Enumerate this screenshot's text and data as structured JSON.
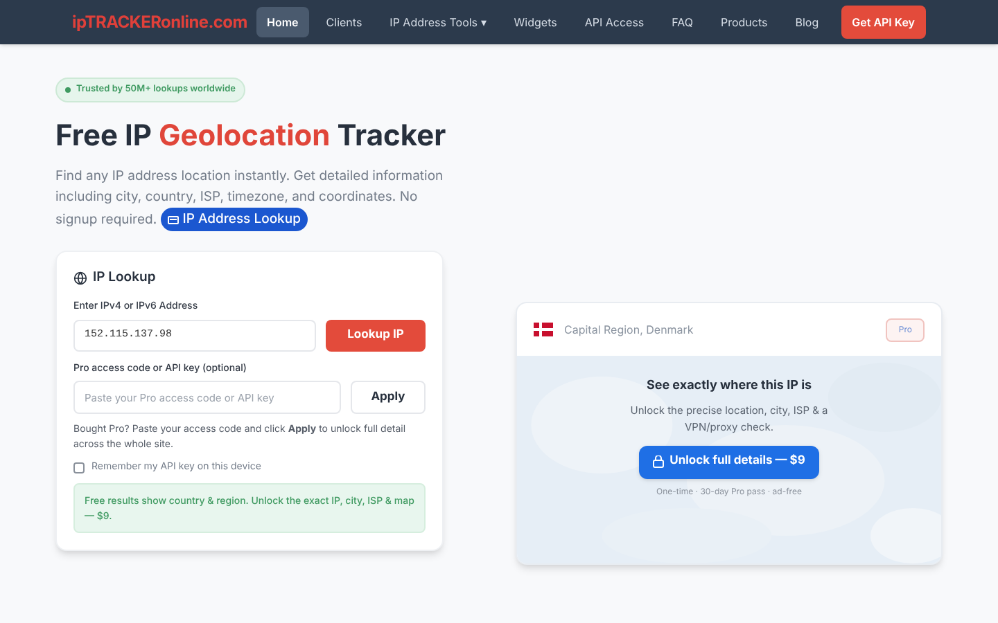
{
  "logo": "ipTRACKERonline.com",
  "nav": [
    {
      "label": "Home",
      "selected": true
    },
    {
      "label": "Clients",
      "selected": false
    },
    {
      "label": "IP Address Tools ▾",
      "selected": false
    },
    {
      "label": "Widgets",
      "selected": false
    },
    {
      "label": "API Access",
      "selected": false
    },
    {
      "label": "FAQ",
      "selected": false
    },
    {
      "label": "Products",
      "selected": false
    },
    {
      "label": "Blog",
      "selected": false
    }
  ],
  "cta": "Get API Key",
  "badge": "Trusted by 50M+ lookups worldwide",
  "heading": {
    "before": "Free IP ",
    "accent": "Geolocation",
    "after": " Tracker"
  },
  "intro": "Find any IP address location instantly. Get detailed information including city, country, ISP, timezone, and coordinates. No signup required.",
  "intro_link": "IP Address Lookup",
  "lookup": {
    "title": "IP Lookup",
    "ip_label": "Enter IPv4 or IPv6 Address",
    "ip_value": "152.115.137.98",
    "lookup_button": "Lookup IP",
    "key_label": "Pro access code or API key (optional)",
    "key_placeholder": "Paste your Pro access code or API key",
    "apply_button": "Apply",
    "help": "Bought Pro? Paste your access code and click **Apply** to unlock full detail across the whole site.",
    "remember": {
      "label": "Remember my API key on this device",
      "checked": false
    },
    "notice": "Free results show country & region. Unlock the exact IP, city, ISP & map — $9."
  },
  "result": {
    "location": "Capital Region, Denmark",
    "pro_badge": "Pro",
    "overlay_title": "See exactly where this IP is",
    "overlay_text": "Unlock the precise location, city, ISP & a VPN/proxy check.",
    "unlock_button": "Unlock full details — $9",
    "fine_print": "One-time · 30-day Pro pass · ad-free"
  }
}
